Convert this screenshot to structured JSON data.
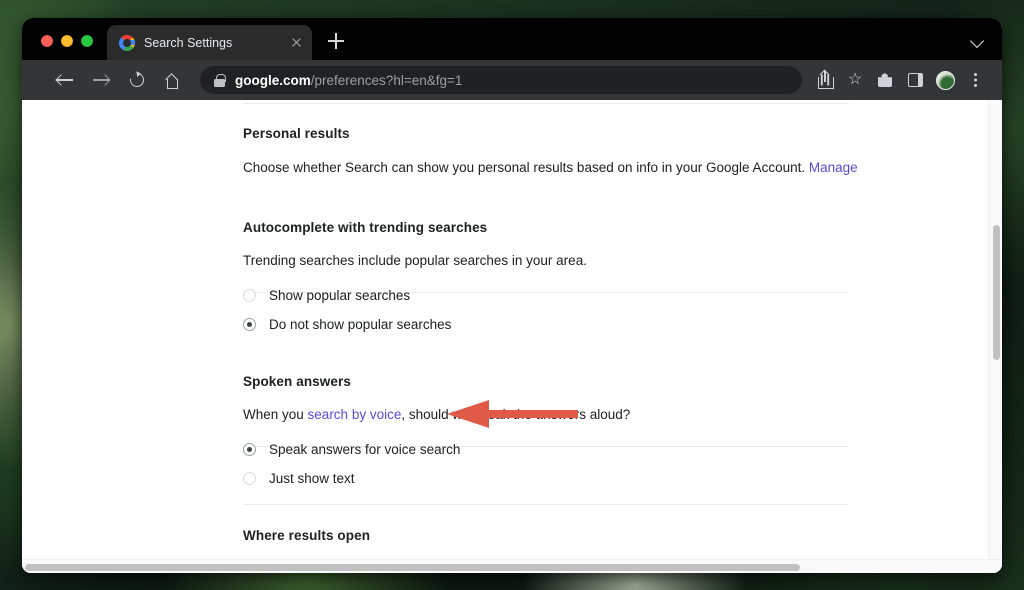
{
  "window": {
    "traffic_lights": [
      "close",
      "minimize",
      "zoom"
    ]
  },
  "tab_strip": {
    "tab": {
      "title": "Search Settings",
      "favicon": "google-g-icon",
      "close": "close-icon"
    },
    "new_tab": "+",
    "tab_search": "chevron-down-icon"
  },
  "toolbar": {
    "back": "back-arrow-icon",
    "forward": "forward-arrow-icon",
    "reload": "reload-icon",
    "home": "home-icon",
    "omnibox": {
      "lock": "lock-icon",
      "host": "google.com",
      "path": "/preferences?hl=en&fg=1"
    },
    "share": "share-icon",
    "bookmark": "star-icon",
    "extensions": "puzzle-icon",
    "side_panel": "side-panel-icon",
    "profile": "avatar-icon",
    "menu": "three-dot-menu-icon"
  },
  "page": {
    "sections": [
      {
        "title": "Personal results",
        "description": "Choose whether Search can show you personal results based on info in your Google Account.",
        "link": "Manage"
      },
      {
        "title": "Autocomplete with trending searches",
        "description": "Trending searches include popular searches in your area.",
        "options": [
          {
            "label": "Show popular searches",
            "selected": false
          },
          {
            "label": "Do not show popular searches",
            "selected": true
          }
        ]
      },
      {
        "title": "Spoken answers",
        "description_before": "When you ",
        "description_link": "search by voice",
        "description_after": ", should we speak the answers aloud?",
        "options": [
          {
            "label": "Speak answers for voice search",
            "selected": true
          },
          {
            "label": "Just show text",
            "selected": false
          }
        ]
      },
      {
        "title": "Where results open"
      }
    ]
  },
  "annotation": {
    "type": "arrow",
    "direction": "left",
    "color": "#e05a47",
    "points_at": "Do not show popular searches"
  },
  "colors": {
    "link": "#5b4bd5",
    "text": "#202124",
    "tab_bar": "#000000",
    "toolbar": "#323639",
    "omnibox": "#202124",
    "annotation_red": "#e05a47"
  }
}
